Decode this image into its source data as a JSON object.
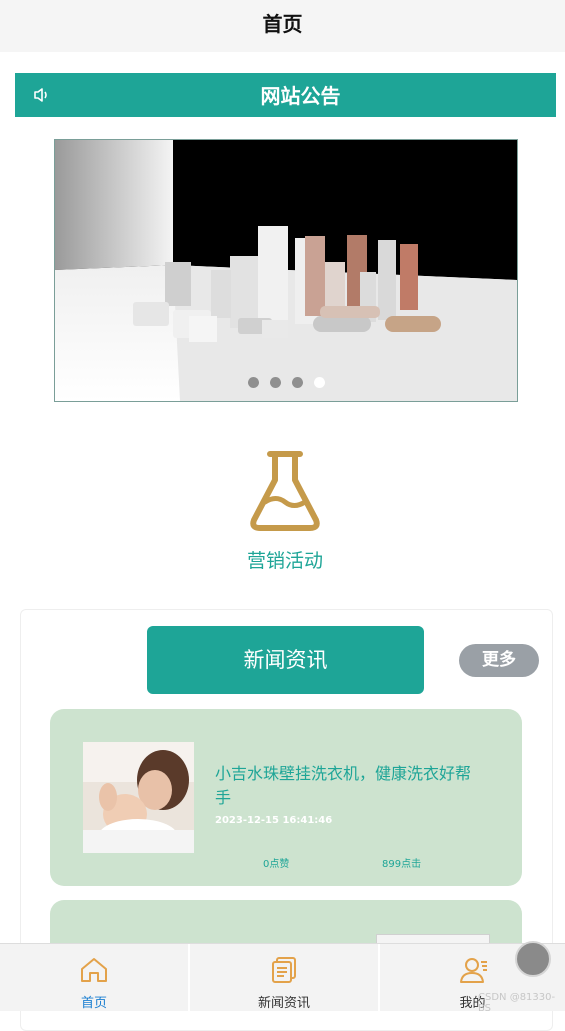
{
  "header": {
    "title": "首页"
  },
  "notice": {
    "title": "网站公告",
    "icon": "speaker-icon"
  },
  "banner": {
    "slide_count": 4,
    "active_slide": 4
  },
  "activity": {
    "label": "营销活动",
    "icon": "flask-icon"
  },
  "news": {
    "section_title": "新闻资讯",
    "more_label": "更多",
    "items": [
      {
        "title": "小吉水珠壁挂洗衣机，健康洗衣好帮手",
        "date": "2023-12-15 16:41:46",
        "likes": "0点赞",
        "clicks": "899点击"
      }
    ]
  },
  "tabbar": {
    "tabs": [
      {
        "label": "首页",
        "icon": "home-icon",
        "active": true
      },
      {
        "label": "新闻资讯",
        "icon": "news-icon",
        "active": false
      },
      {
        "label": "我的",
        "icon": "user-icon",
        "active": false
      }
    ]
  },
  "watermark": "CSDN @81330-BS",
  "colors": {
    "accent": "#1ea597",
    "card_bg": "#cde3cf",
    "flask": "#c59a4a",
    "tab_active": "#1b7fd1"
  }
}
